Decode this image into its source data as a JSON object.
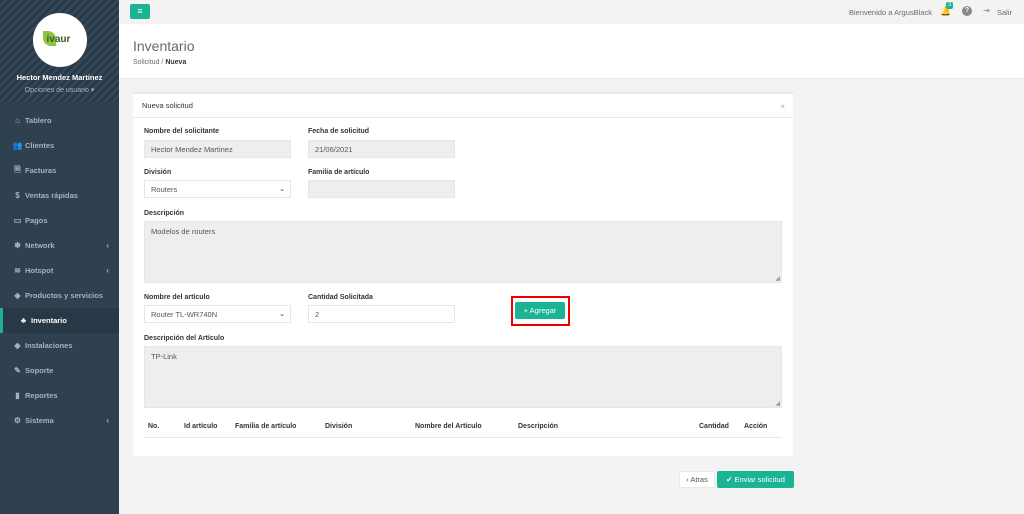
{
  "brand": {
    "logo_text": "ivaur",
    "accent": "#1ab394",
    "sidebar_bg": "#2f4050"
  },
  "profile": {
    "name": "Hector Mendez Martinez",
    "options": "Opciones de usuario",
    "options_caret": "▾"
  },
  "sidebar": {
    "items": [
      {
        "label": "Tablero",
        "icon": "⌂"
      },
      {
        "label": "Clientes",
        "icon": "👥"
      },
      {
        "label": "Facturas",
        "icon": "🗎"
      },
      {
        "label": "Ventas rápidas",
        "icon": "$"
      },
      {
        "label": "Pagos",
        "icon": "▭"
      },
      {
        "label": "Network",
        "icon": "✱",
        "caret": "‹"
      },
      {
        "label": "Hotspot",
        "icon": "≋",
        "caret": "‹"
      },
      {
        "label": "Productos y servicios",
        "icon": "◈"
      },
      {
        "label": "Inventario",
        "icon": "♣"
      },
      {
        "label": "Instalaciones",
        "icon": "◆"
      },
      {
        "label": "Soporte",
        "icon": "✎"
      },
      {
        "label": "Reportes",
        "icon": "▮"
      },
      {
        "label": "Sistema",
        "icon": "⚙",
        "caret": "‹"
      }
    ]
  },
  "topbar": {
    "menu_icon": "≡",
    "welcome": "Bienvenido a ArgusBlack",
    "notifications_count": "3",
    "bell_icon": "🔔",
    "help_icon": "?",
    "exit_icon": "⇥",
    "exit_label": "Salir"
  },
  "page": {
    "title": "Inventario",
    "breadcrumb": {
      "parent": "Solicitud",
      "separator": "/",
      "current": "Nueva"
    }
  },
  "form": {
    "panel_title": "Nueva solicitud",
    "close_icon": "×",
    "solicitante": {
      "label": "Nombre del solicitante",
      "value": "Hector Mendez Martinez"
    },
    "fecha": {
      "label": "Fecha de solicitud",
      "value": "21/06/2021"
    },
    "division": {
      "label": "División",
      "value": "Routers"
    },
    "familia": {
      "label": "Familia de artículo",
      "value": ""
    },
    "descripcion": {
      "label": "Descripción",
      "value": "Modelos de routers"
    },
    "articulo": {
      "label": "Nombre del artículo",
      "value": "Router TL-WR740N"
    },
    "cantidad": {
      "label": "Cantidad Solicitada",
      "value": "2"
    },
    "add_button": "+ Agregar",
    "desc_articulo": {
      "label": "Descripción del Artículo",
      "value": "TP-Link"
    },
    "select_caret": "⌄",
    "resize_grip": "◢",
    "table_headers": [
      "No.",
      "Id artículo",
      "Familia de artículo",
      "División",
      "Nombre del Artículo",
      "Descripción",
      "Cantidad",
      "Acción"
    ]
  },
  "actions": {
    "back": "‹ Atras",
    "send": "✔ Enviar solicitud"
  }
}
